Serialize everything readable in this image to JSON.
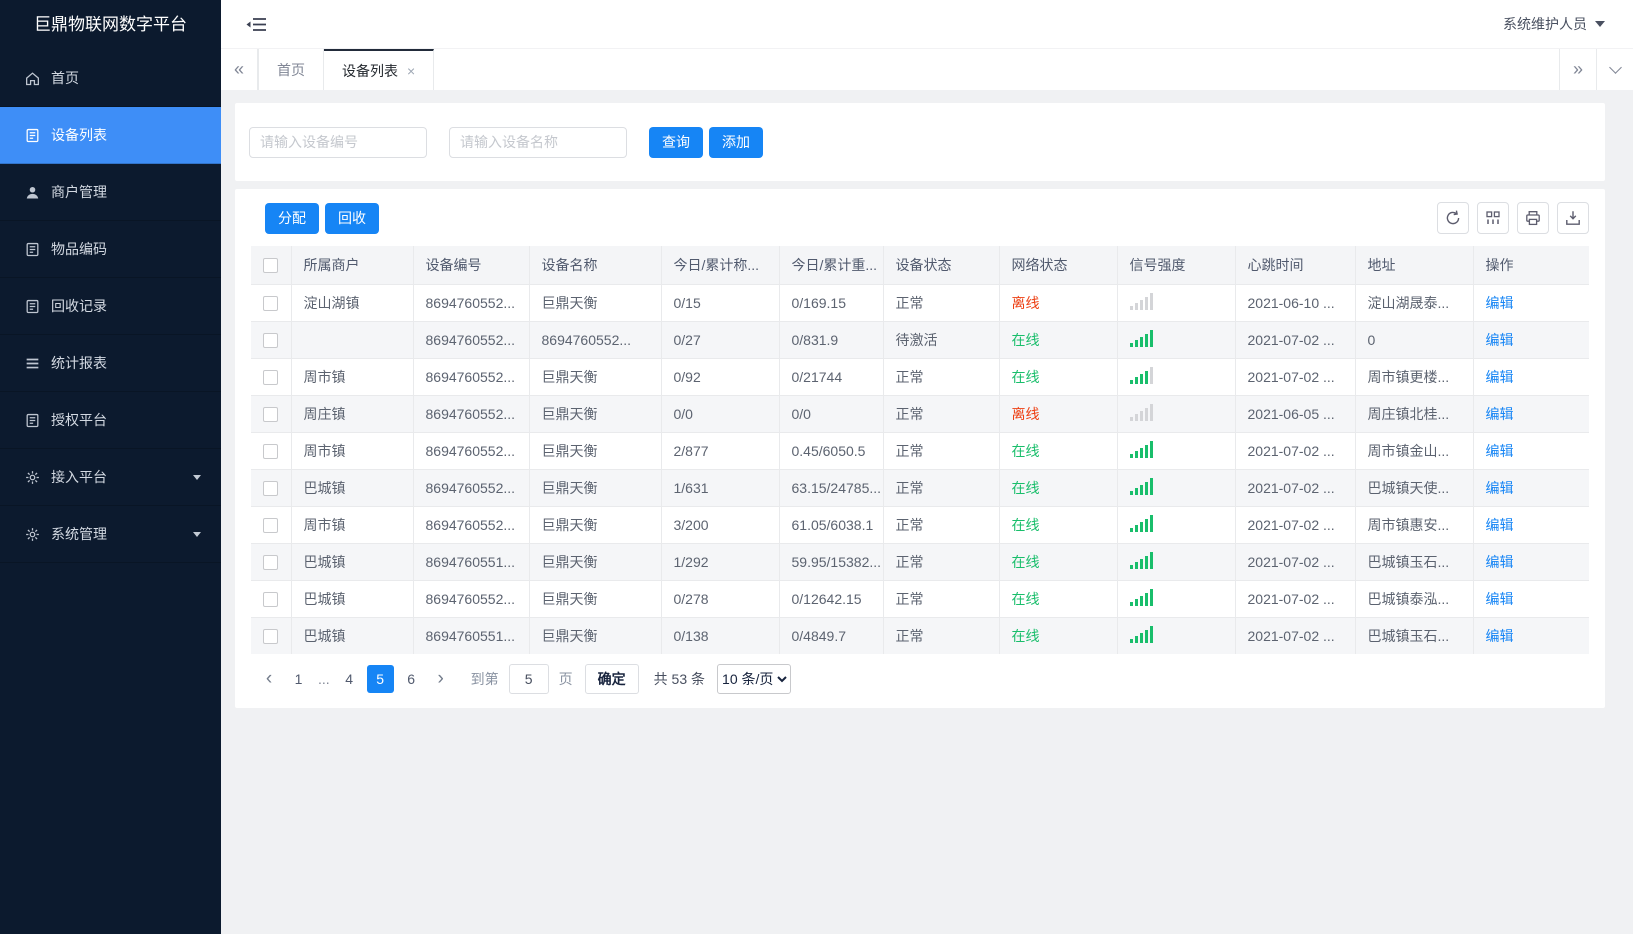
{
  "colors": {
    "primary": "#1685f5",
    "sidebar_bg": "#0c1a2e",
    "sidebar_active": "#3e8ef7",
    "online": "#19be6b",
    "offline": "#ed4014"
  },
  "sidebar": {
    "logo": "巨鼎物联网数字平台",
    "items": [
      {
        "label": "首页",
        "icon": "home-icon",
        "active": false,
        "expandable": false
      },
      {
        "label": "设备列表",
        "icon": "clipboard-icon",
        "active": true,
        "expandable": false
      },
      {
        "label": "商户管理",
        "icon": "user-icon",
        "active": false,
        "expandable": false
      },
      {
        "label": "物品编码",
        "icon": "clipboard-icon",
        "active": false,
        "expandable": false
      },
      {
        "label": "回收记录",
        "icon": "clipboard-icon",
        "active": false,
        "expandable": false
      },
      {
        "label": "统计报表",
        "icon": "menu-lines-icon",
        "active": false,
        "expandable": false
      },
      {
        "label": "授权平台",
        "icon": "clipboard-icon",
        "active": false,
        "expandable": false
      },
      {
        "label": "接入平台",
        "icon": "gear-icon",
        "active": false,
        "expandable": true
      },
      {
        "label": "系统管理",
        "icon": "gear-icon",
        "active": false,
        "expandable": true
      }
    ]
  },
  "header": {
    "user_name": "系统维护人员"
  },
  "tabbar": {
    "collapse_left_glyph": "«",
    "expand_right_glyph": "»",
    "close_glyph": "×",
    "tabs": [
      {
        "label": "首页",
        "active": false,
        "closable": false
      },
      {
        "label": "设备列表",
        "active": true,
        "closable": true
      }
    ]
  },
  "filters": {
    "device_no_placeholder": "请输入设备编号",
    "device_name_placeholder": "请输入设备名称",
    "search_label": "查询",
    "add_label": "添加"
  },
  "toolbar": {
    "assign_label": "分配",
    "recycle_label": "回收",
    "icons": [
      "refresh-icon",
      "column-settings-icon",
      "print-icon",
      "download-icon"
    ]
  },
  "table": {
    "columns": [
      "所属商户",
      "设备编号",
      "设备名称",
      "今日/累计称...",
      "今日/累计重...",
      "设备状态",
      "网络状态",
      "信号强度",
      "心跳时间",
      "地址",
      "操作"
    ],
    "edit_label": "编辑",
    "rows": [
      {
        "merchant": "淀山湖镇",
        "device_no": "8694760552...",
        "device_name": "巨鼎天衡",
        "today_count": "0/15",
        "today_weight": "0/169.15",
        "device_status": "正常",
        "network_status": "离线",
        "online": false,
        "signal_level": 0,
        "heartbeat": "2021-06-10 ...",
        "address": "淀山湖晟泰..."
      },
      {
        "merchant": "",
        "device_no": "8694760552...",
        "device_name": "8694760552...",
        "today_count": "0/27",
        "today_weight": "0/831.9",
        "device_status": "待激活",
        "network_status": "在线",
        "online": true,
        "signal_level": 5,
        "heartbeat": "2021-07-02 ...",
        "address": "0"
      },
      {
        "merchant": "周市镇",
        "device_no": "8694760552...",
        "device_name": "巨鼎天衡",
        "today_count": "0/92",
        "today_weight": "0/21744",
        "device_status": "正常",
        "network_status": "在线",
        "online": true,
        "signal_level": 4,
        "heartbeat": "2021-07-02 ...",
        "address": "周市镇更楼..."
      },
      {
        "merchant": "周庄镇",
        "device_no": "8694760552...",
        "device_name": "巨鼎天衡",
        "today_count": "0/0",
        "today_weight": "0/0",
        "device_status": "正常",
        "network_status": "离线",
        "online": false,
        "signal_level": 0,
        "heartbeat": "2021-06-05 ...",
        "address": "周庄镇北桂..."
      },
      {
        "merchant": "周市镇",
        "device_no": "8694760552...",
        "device_name": "巨鼎天衡",
        "today_count": "2/877",
        "today_weight": "0.45/6050.5",
        "device_status": "正常",
        "network_status": "在线",
        "online": true,
        "signal_level": 5,
        "heartbeat": "2021-07-02 ...",
        "address": "周市镇金山..."
      },
      {
        "merchant": "巴城镇",
        "device_no": "8694760552...",
        "device_name": "巨鼎天衡",
        "today_count": "1/631",
        "today_weight": "63.15/24785...",
        "device_status": "正常",
        "network_status": "在线",
        "online": true,
        "signal_level": 5,
        "heartbeat": "2021-07-02 ...",
        "address": "巴城镇天使..."
      },
      {
        "merchant": "周市镇",
        "device_no": "8694760552...",
        "device_name": "巨鼎天衡",
        "today_count": "3/200",
        "today_weight": "61.05/6038.1",
        "device_status": "正常",
        "network_status": "在线",
        "online": true,
        "signal_level": 5,
        "heartbeat": "2021-07-02 ...",
        "address": "周市镇惠安..."
      },
      {
        "merchant": "巴城镇",
        "device_no": "8694760551...",
        "device_name": "巨鼎天衡",
        "today_count": "1/292",
        "today_weight": "59.95/15382...",
        "device_status": "正常",
        "network_status": "在线",
        "online": true,
        "signal_level": 5,
        "heartbeat": "2021-07-02 ...",
        "address": "巴城镇玉石..."
      },
      {
        "merchant": "巴城镇",
        "device_no": "8694760552...",
        "device_name": "巨鼎天衡",
        "today_count": "0/278",
        "today_weight": "0/12642.15",
        "device_status": "正常",
        "network_status": "在线",
        "online": true,
        "signal_level": 5,
        "heartbeat": "2021-07-02 ...",
        "address": "巴城镇泰泓..."
      },
      {
        "merchant": "巴城镇",
        "device_no": "8694760551...",
        "device_name": "巨鼎天衡",
        "today_count": "0/138",
        "today_weight": "0/4849.7",
        "device_status": "正常",
        "network_status": "在线",
        "online": true,
        "signal_level": 5,
        "heartbeat": "2021-07-02 ...",
        "address": "巴城镇玉石..."
      }
    ]
  },
  "pagination": {
    "prev_glyph": "‹",
    "next_glyph": "›",
    "pages": [
      "1",
      "...",
      "4",
      "5",
      "6"
    ],
    "active_page": "5",
    "goto_label": "到第",
    "page_value": "5",
    "page_unit": "页",
    "confirm_label": "确定",
    "total_label": "共 53 条",
    "page_size": "10 条/页"
  }
}
